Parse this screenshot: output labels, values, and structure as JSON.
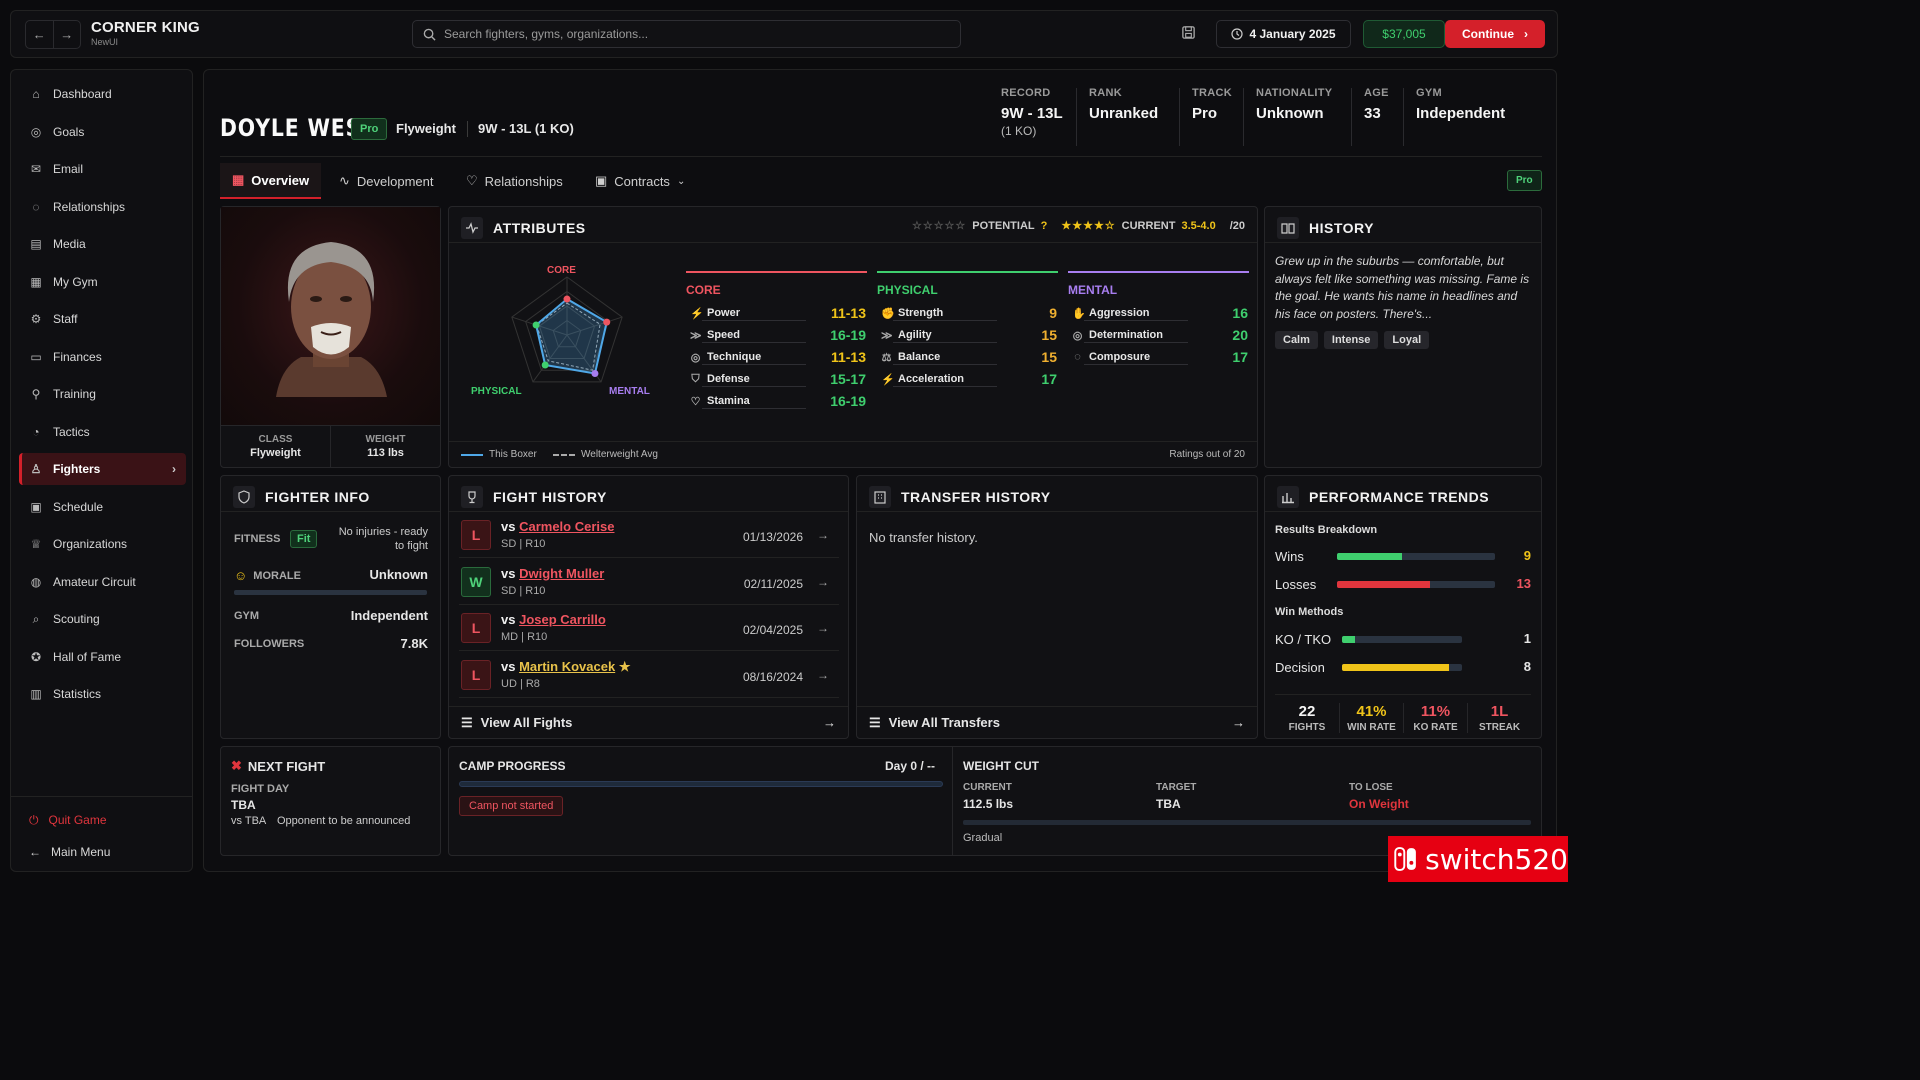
{
  "app": {
    "title": "CORNER KING",
    "subtitle": "NewUI"
  },
  "topbar": {
    "search_placeholder": "Search fighters, gyms, organizations...",
    "date": "4 January 2025",
    "money": "$37,005",
    "continue_label": "Continue"
  },
  "sidebar": {
    "items": [
      {
        "label": "Dashboard",
        "icon": "home-icon"
      },
      {
        "label": "Goals",
        "icon": "target-icon"
      },
      {
        "label": "Email",
        "icon": "mail-icon"
      },
      {
        "label": "Relationships",
        "icon": "chat-icon"
      },
      {
        "label": "Media",
        "icon": "newspaper-icon"
      },
      {
        "label": "My Gym",
        "icon": "building-icon"
      },
      {
        "label": "Staff",
        "icon": "gear-icon"
      },
      {
        "label": "Finances",
        "icon": "wallet-icon"
      },
      {
        "label": "Training",
        "icon": "dumbbell-icon"
      },
      {
        "label": "Tactics",
        "icon": "clock-icon"
      },
      {
        "label": "Fighters",
        "icon": "users-icon",
        "active": true
      },
      {
        "label": "Schedule",
        "icon": "calendar-icon"
      },
      {
        "label": "Organizations",
        "icon": "trophy-icon"
      },
      {
        "label": "Amateur Circuit",
        "icon": "globe-icon"
      },
      {
        "label": "Scouting",
        "icon": "search-icon"
      },
      {
        "label": "Hall of Fame",
        "icon": "award-icon"
      },
      {
        "label": "Statistics",
        "icon": "chart-icon"
      }
    ],
    "quit_label": "Quit Game",
    "main_menu_label": "Main Menu"
  },
  "fighter": {
    "name": "DOYLE WEST",
    "badge": "Pro",
    "weight_class": "Flyweight",
    "record_short": "9W - 13L (1 KO)"
  },
  "header_stats": [
    {
      "label": "RECORD",
      "value": "9W - 13L",
      "sub": "(1 KO)"
    },
    {
      "label": "RANK",
      "value": "Unranked"
    },
    {
      "label": "TRACK",
      "value": "Pro"
    },
    {
      "label": "NATIONALITY",
      "value": "Unknown"
    },
    {
      "label": "AGE",
      "value": "33"
    },
    {
      "label": "GYM",
      "value": "Independent"
    }
  ],
  "tabs": [
    "Overview",
    "Development",
    "Relationships",
    "Contracts"
  ],
  "tab_badge": "Pro",
  "portrait": {
    "class_label": "CLASS",
    "class_value": "Flyweight",
    "weight_label": "WEIGHT",
    "weight_value": "113 lbs"
  },
  "attributes": {
    "title": "ATTRIBUTES",
    "potential_label": "POTENTIAL",
    "potential_value": "?",
    "potential_stars": 0,
    "current_label": "CURRENT",
    "current_stars": 4,
    "current_value": "3.5-4.0",
    "out_of": "/20",
    "radar_labels": {
      "core": "CORE",
      "physical": "PHYSICAL",
      "mental": "MENTAL"
    },
    "radar_this": [
      0.62,
      0.72,
      0.82,
      0.64,
      0.56
    ],
    "radar_avg": [
      0.55,
      0.6,
      0.75,
      0.55,
      0.55
    ],
    "groups": {
      "core": {
        "label": "CORE",
        "items": [
          {
            "name": "Power",
            "value": "11-13"
          },
          {
            "name": "Speed",
            "value": "16-19"
          },
          {
            "name": "Technique",
            "value": "11-13"
          },
          {
            "name": "Defense",
            "value": "15-17"
          },
          {
            "name": "Stamina",
            "value": "16-19"
          }
        ]
      },
      "physical": {
        "label": "PHYSICAL",
        "items": [
          {
            "name": "Strength",
            "value": "9"
          },
          {
            "name": "Agility",
            "value": "15"
          },
          {
            "name": "Balance",
            "value": "15"
          },
          {
            "name": "Acceleration",
            "value": "17"
          }
        ]
      },
      "mental": {
        "label": "MENTAL",
        "items": [
          {
            "name": "Aggression",
            "value": "16"
          },
          {
            "name": "Determination",
            "value": "20"
          },
          {
            "name": "Composure",
            "value": "17"
          }
        ]
      }
    },
    "legend_this": "This Boxer",
    "legend_avg": "Welterweight Avg",
    "footnote": "Ratings out of 20"
  },
  "history": {
    "title": "HISTORY",
    "text": "Grew up in the suburbs — comfortable, but always felt like something was missing. Fame is the goal. He wants his name in headlines and his face on posters. There's...",
    "tags": [
      "Calm",
      "Intense",
      "Loyal"
    ]
  },
  "fighter_info": {
    "title": "FIGHTER INFO",
    "fitness_label": "FITNESS",
    "fitness_badge": "Fit",
    "fitness_note": "No injuries - ready to fight",
    "morale_label": "MORALE",
    "morale_value": "Unknown",
    "gym_label": "GYM",
    "gym_value": "Independent",
    "followers_label": "FOLLOWERS",
    "followers_value": "7.8K"
  },
  "fight_history": {
    "title": "FIGHT HISTORY",
    "fights": [
      {
        "result": "L",
        "vs": "vs",
        "opponent": "Carmelo Cerise",
        "method": "SD | R10",
        "date": "01/13/2026"
      },
      {
        "result": "W",
        "vs": "vs",
        "opponent": "Dwight Muller",
        "method": "SD | R10",
        "date": "02/11/2025"
      },
      {
        "result": "L",
        "vs": "vs",
        "opponent": "Josep Carrillo",
        "method": "MD | R10",
        "date": "02/04/2025"
      },
      {
        "result": "L",
        "vs": "vs",
        "opponent": "Martin Kovacek",
        "method": "UD | R8",
        "date": "08/16/2024",
        "star": true
      }
    ],
    "view_all": "View All Fights"
  },
  "transfer_history": {
    "title": "TRANSFER HISTORY",
    "empty": "No transfer history.",
    "view_all": "View All Transfers"
  },
  "performance": {
    "title": "PERFORMANCE TRENDS",
    "results_label": "Results Breakdown",
    "wins_label": "Wins",
    "wins_value": "9",
    "wins_fraction": 0.41,
    "losses_label": "Losses",
    "losses_value": "13",
    "losses_fraction": 0.59,
    "methods_label": "Win Methods",
    "ko_label": "KO / TKO",
    "ko_value": "1",
    "ko_fraction": 0.11,
    "dec_label": "Decision",
    "dec_value": "8",
    "dec_fraction": 0.89,
    "stats": [
      {
        "value": "22",
        "label": "FIGHTS",
        "color": "#f5f5f5"
      },
      {
        "value": "41%",
        "label": "WIN RATE",
        "color": "#f0c419"
      },
      {
        "value": "11%",
        "label": "KO RATE",
        "color": "#ef5560"
      },
      {
        "value": "1L",
        "label": "STREAK",
        "color": "#ef5560"
      }
    ]
  },
  "next_fight": {
    "title": "NEXT FIGHT",
    "day_label": "FIGHT DAY",
    "day_value": "TBA",
    "vs_label": "vs TBA",
    "note": "Opponent to be announced"
  },
  "camp": {
    "title": "CAMP PROGRESS",
    "day": "Day 0 / --",
    "status": "Camp not started",
    "progress": 0
  },
  "weight_cut": {
    "title": "WEIGHT CUT",
    "current_label": "CURRENT",
    "current_value": "112.5 lbs",
    "target_label": "TARGET",
    "target_value": "TBA",
    "lose_label": "TO LOSE",
    "lose_value": "On Weight",
    "pace": "Gradual"
  },
  "watermark": "switch520",
  "colors": {
    "accent": "#d4202a",
    "green": "#3fcf6e",
    "yellow": "#f0c419",
    "core": "#ef5560",
    "physical": "#3fcf6e",
    "mental": "#a87ef0"
  }
}
